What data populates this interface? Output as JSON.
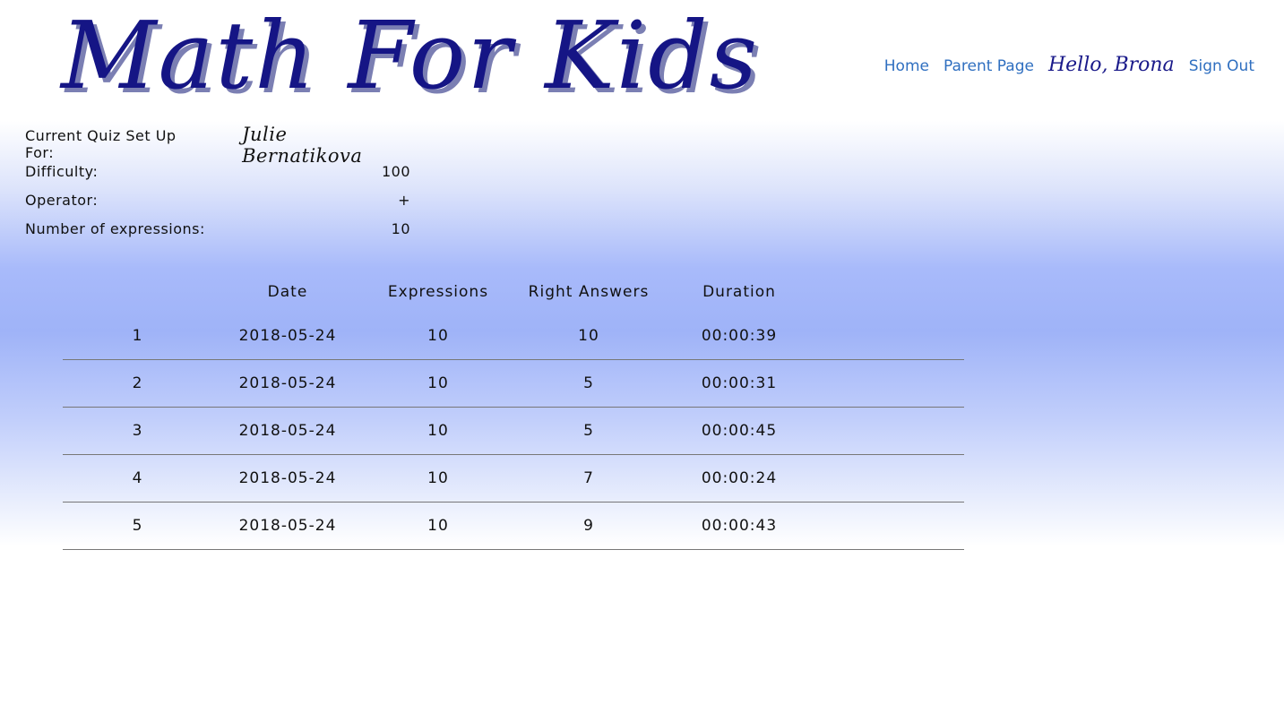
{
  "header": {
    "logo_text": "Math For Kids",
    "nav": {
      "home": "Home",
      "parent_page": "Parent Page",
      "greeting": "Hello, Brona",
      "sign_out": "Sign Out"
    }
  },
  "quiz": {
    "setup_label": "Current Quiz Set Up For:",
    "child_name": "Julie Bernatikova",
    "difficulty_label": "Difficulty:",
    "difficulty_value": "100",
    "operator_label": "Operator:",
    "operator_value": "+",
    "expressions_label": "Number of expressions:",
    "expressions_value": "10"
  },
  "results": {
    "headers": [
      "",
      "Date",
      "Expressions",
      "Right Answers",
      "Duration"
    ],
    "rows": [
      [
        "1",
        "2018-05-24",
        "10",
        "10",
        "00:00:39"
      ],
      [
        "2",
        "2018-05-24",
        "10",
        "5",
        "00:00:31"
      ],
      [
        "3",
        "2018-05-24",
        "10",
        "5",
        "00:00:45"
      ],
      [
        "4",
        "2018-05-24",
        "10",
        "7",
        "00:00:24"
      ],
      [
        "5",
        "2018-05-24",
        "10",
        "9",
        "00:00:43"
      ]
    ]
  },
  "colors": {
    "logo": "#151585",
    "nav_link": "#2f6fc0",
    "gradient_mid": "#9fb3f8"
  }
}
